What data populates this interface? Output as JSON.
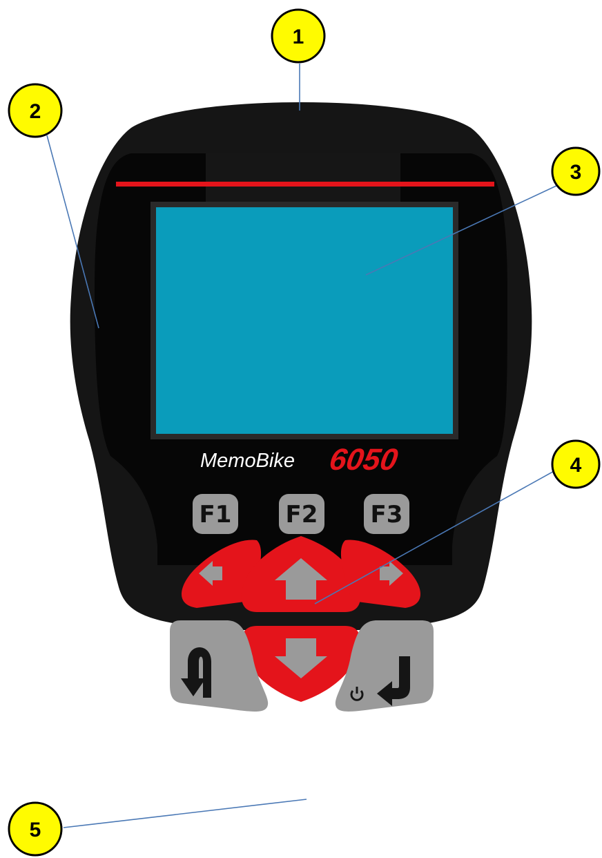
{
  "device": {
    "brand_name": "MemoBike",
    "brand_model": "6050",
    "function_keys": [
      "F1",
      "F2",
      "F3"
    ],
    "keys": [
      "left-arrow",
      "up-arrow",
      "right-arrow",
      "down-arrow",
      "back",
      "enter-power"
    ],
    "colors": {
      "body": "#151515",
      "screen": "#0a9cbb",
      "accent_red": "#e4141b",
      "key_grey": "#9a9a9a",
      "callout_fill": "#fffb00",
      "leader_line": "#4a78b5"
    }
  },
  "callouts": [
    {
      "label": "1"
    },
    {
      "label": "2"
    },
    {
      "label": "3"
    },
    {
      "label": "4"
    },
    {
      "label": "5"
    }
  ]
}
